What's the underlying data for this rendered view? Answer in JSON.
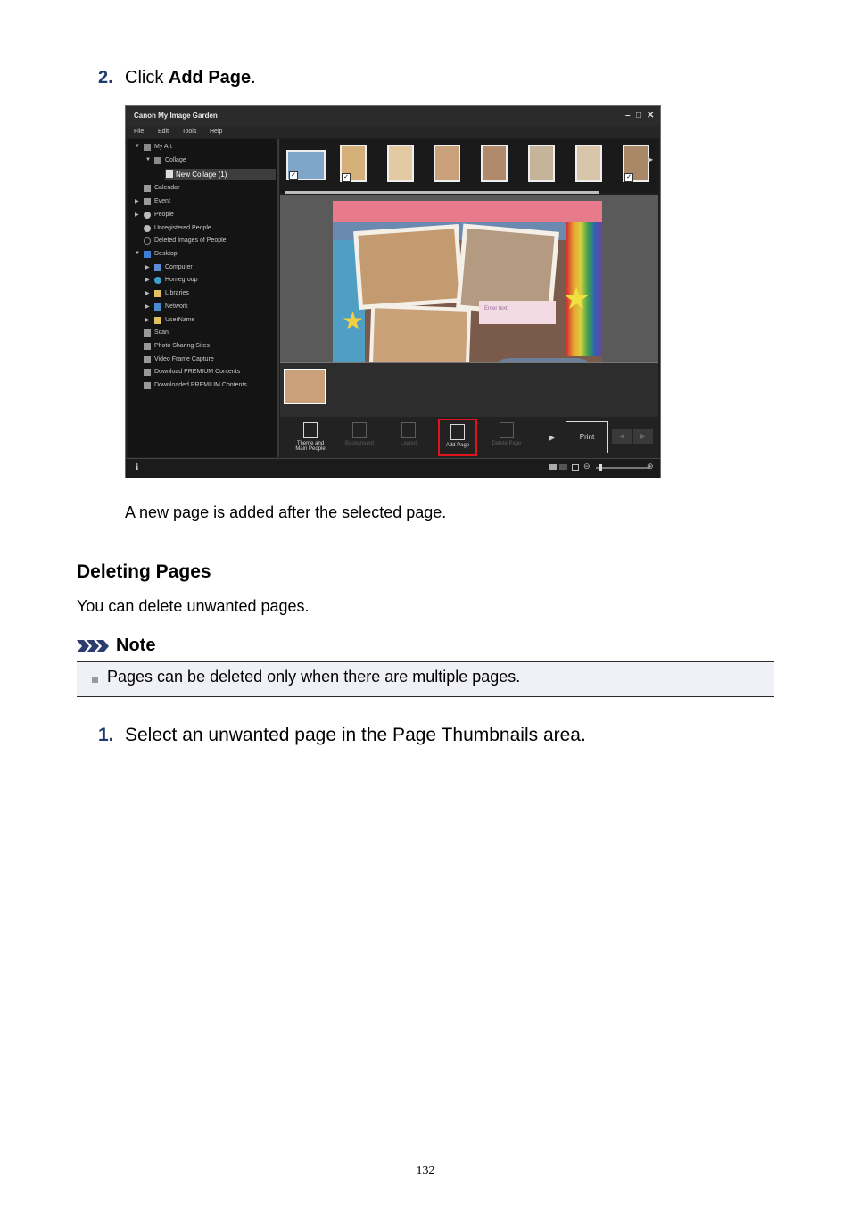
{
  "step2": {
    "num": "2.",
    "text_pre": "Click ",
    "text_bold": "Add Page",
    "text_post": "."
  },
  "app": {
    "title": "Canon My Image Garden",
    "menu": [
      "File",
      "Edit",
      "Tools",
      "Help"
    ],
    "window_controls": [
      "–",
      "□",
      "✕"
    ],
    "tree": [
      {
        "label": "My Art",
        "icon": "my-art-icon"
      },
      {
        "label": "Collage",
        "icon": "collage-icon"
      },
      {
        "label": "New Collage (1)",
        "icon": "collage-item-icon"
      },
      {
        "label": "Calendar",
        "icon": "calendar-icon"
      },
      {
        "label": "Event",
        "icon": "event-icon"
      },
      {
        "label": "People",
        "icon": "people-icon"
      },
      {
        "label": "Unregistered People",
        "icon": "unregistered-people-icon"
      },
      {
        "label": "Deleted Images of People",
        "icon": "deleted-people-icon"
      },
      {
        "label": "Desktop",
        "icon": "desktop-icon"
      },
      {
        "label": "Computer",
        "icon": "computer-icon"
      },
      {
        "label": "Homegroup",
        "icon": "homegroup-icon"
      },
      {
        "label": "Libraries",
        "icon": "libraries-icon"
      },
      {
        "label": "Network",
        "icon": "network-icon"
      },
      {
        "label": "UserName",
        "icon": "user-folder-icon"
      },
      {
        "label": "Scan",
        "icon": "scan-icon"
      },
      {
        "label": "Photo Sharing Sites",
        "icon": "photo-sharing-icon"
      },
      {
        "label": "Video Frame Capture",
        "icon": "video-capture-icon"
      },
      {
        "label": "Download PREMIUM Contents",
        "icon": "download-icon"
      },
      {
        "label": "Downloaded PREMIUM Contents",
        "icon": "downloaded-icon"
      }
    ],
    "collage_text": {
      "enter_text": "Enter text."
    },
    "toolbar": {
      "theme": "Theme and Main People",
      "background": "Background",
      "layout": "Layout",
      "add_page": "Add Page",
      "delete_page": "Delete Page",
      "print": "Print"
    },
    "highlight_color": "#e0141c"
  },
  "caption": "A new page is added after the selected page.",
  "section_title": "Deleting Pages",
  "section_intro": "You can delete unwanted pages.",
  "note": {
    "title": "Note",
    "icon": "note-arrows-icon",
    "items": [
      "Pages can be deleted only when there are multiple pages."
    ]
  },
  "step1": {
    "num": "1.",
    "text": "Select an unwanted page in the Page Thumbnails area."
  },
  "page_number": "132"
}
